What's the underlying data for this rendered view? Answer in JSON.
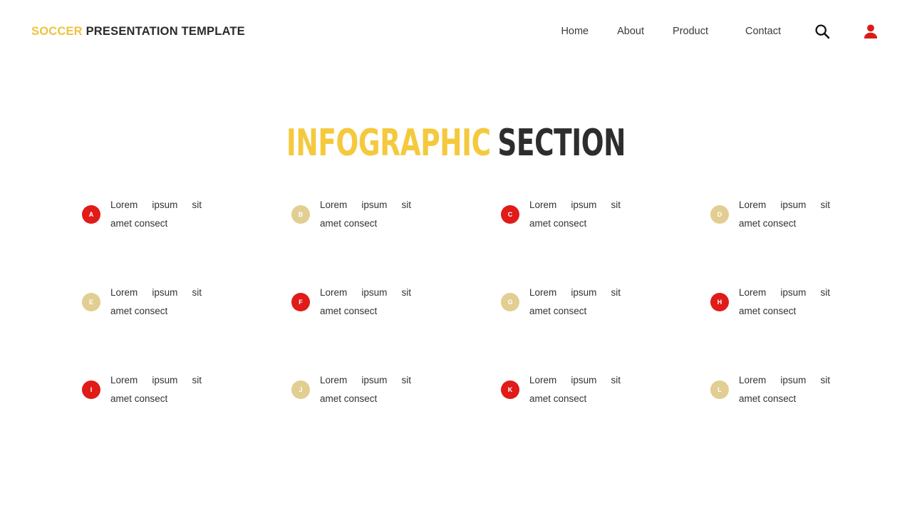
{
  "header": {
    "brand_accent": "SOCCER",
    "brand_rest": "PRESENTATION TEMPLATE",
    "nav": [
      {
        "label": "Home"
      },
      {
        "label": "About"
      },
      {
        "label": "Product"
      },
      {
        "label": "Contact"
      }
    ],
    "search_icon": "search-icon",
    "user_icon": "user-avatar-icon"
  },
  "title": {
    "accent": "INFOGRAPHIC",
    "rest": "SECTION"
  },
  "colors": {
    "accent_yellow": "#F5C93D",
    "brand_yellow": "#EFC23F",
    "red": "#E01B18",
    "tan": "#E2CE92",
    "dark": "#2d2d2d",
    "text": "#333333",
    "background": "#ffffff"
  },
  "items": [
    {
      "letter": "A",
      "color": "#E01B18",
      "letter_color": "#ffffff",
      "line1": "Lorem ipsum sit",
      "line2": "amet consect"
    },
    {
      "letter": "B",
      "color": "#E2CE92",
      "letter_color": "#ffffff",
      "line1": "Lorem ipsum sit",
      "line2": "amet consect"
    },
    {
      "letter": "C",
      "color": "#E01B18",
      "letter_color": "#ffffff",
      "line1": "Lorem ipsum sit",
      "line2": "amet consect"
    },
    {
      "letter": "D",
      "color": "#E2CE92",
      "letter_color": "#ffffff",
      "line1": "Lorem ipsum sit",
      "line2": "amet consect"
    },
    {
      "letter": "E",
      "color": "#E2CE92",
      "letter_color": "#ffffff",
      "line1": "Lorem ipsum sit",
      "line2": "amet consect"
    },
    {
      "letter": "F",
      "color": "#E01B18",
      "letter_color": "#ffffff",
      "line1": "Lorem ipsum sit",
      "line2": "amet consect"
    },
    {
      "letter": "G",
      "color": "#E2CE92",
      "letter_color": "#ffffff",
      "line1": "Lorem ipsum sit",
      "line2": "amet consect"
    },
    {
      "letter": "H",
      "color": "#E01B18",
      "letter_color": "#ffffff",
      "line1": "Lorem ipsum sit",
      "line2": "amet consect"
    },
    {
      "letter": "I",
      "color": "#E01B18",
      "letter_color": "#ffffff",
      "line1": "Lorem ipsum sit",
      "line2": "amet consect"
    },
    {
      "letter": "J",
      "color": "#E2CE92",
      "letter_color": "#ffffff",
      "line1": "Lorem ipsum sit",
      "line2": "amet consect"
    },
    {
      "letter": "K",
      "color": "#E01B18",
      "letter_color": "#ffffff",
      "line1": "Lorem ipsum sit",
      "line2": "amet consect"
    },
    {
      "letter": "L",
      "color": "#E2CE92",
      "letter_color": "#ffffff",
      "line1": "Lorem ipsum sit",
      "line2": "amet consect"
    }
  ]
}
